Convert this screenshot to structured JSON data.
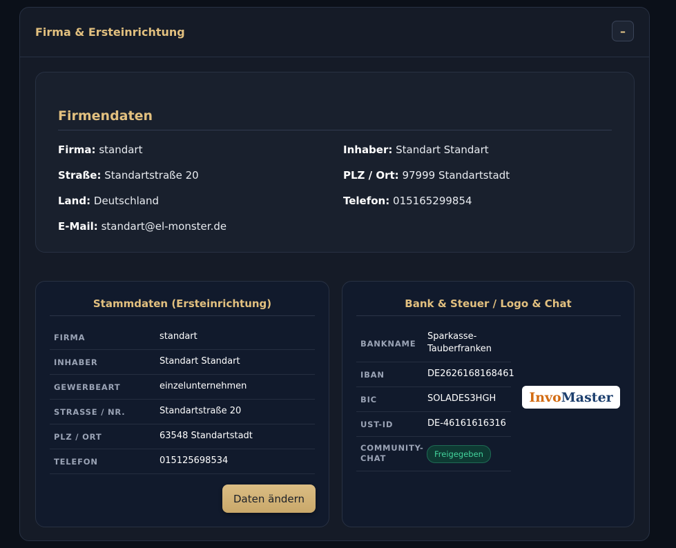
{
  "panel": {
    "title": "Firma & Ersteinrichtung",
    "collapse_label": "–"
  },
  "firmendaten": {
    "heading": "Firmendaten",
    "left": [
      {
        "label": "Firma:",
        "value": "standart"
      },
      {
        "label": "Straße:",
        "value": "Standartstraße 20"
      },
      {
        "label": "Land:",
        "value": "Deutschland"
      },
      {
        "label": "E-Mail:",
        "value": "standart@el-monster.de"
      }
    ],
    "right": [
      {
        "label": "Inhaber:",
        "value": "Standart Standart"
      },
      {
        "label": "PLZ / Ort:",
        "value": "97999 Standartstadt"
      },
      {
        "label": "Telefon:",
        "value": "015165299854"
      }
    ]
  },
  "stammdaten": {
    "title": "Stammdaten (Ersteinrichtung)",
    "rows": [
      {
        "label": "Firma",
        "value": "standart"
      },
      {
        "label": "Inhaber",
        "value": "Standart Standart"
      },
      {
        "label": "Gewerbeart",
        "value": "einzelunternehmen"
      },
      {
        "label": "Strasse / Nr.",
        "value": "Standartstraße 20"
      },
      {
        "label": "PLZ / Ort",
        "value": "63548 Standartstadt"
      },
      {
        "label": "Telefon",
        "value": "015125698534"
      }
    ],
    "edit_button": "Daten ändern"
  },
  "bank": {
    "title": "Bank & Steuer / Logo & Chat",
    "rows": [
      {
        "label": "Bankname",
        "value": "Sparkasse-\nTauberfranken"
      },
      {
        "label": "IBAN",
        "value": "DE2626168168461"
      },
      {
        "label": "BIC",
        "value": "SOLADES3HGH"
      },
      {
        "label": "USt-ID",
        "value": "DE-46161616316"
      },
      {
        "label": "Community-\nChat",
        "value": ""
      }
    ],
    "chat_status": "Freigegeben",
    "logo": {
      "part1": "Invo",
      "part2": "Master"
    }
  },
  "colors": {
    "accent": "#e2c07f",
    "badge_green": "#43d49c"
  }
}
